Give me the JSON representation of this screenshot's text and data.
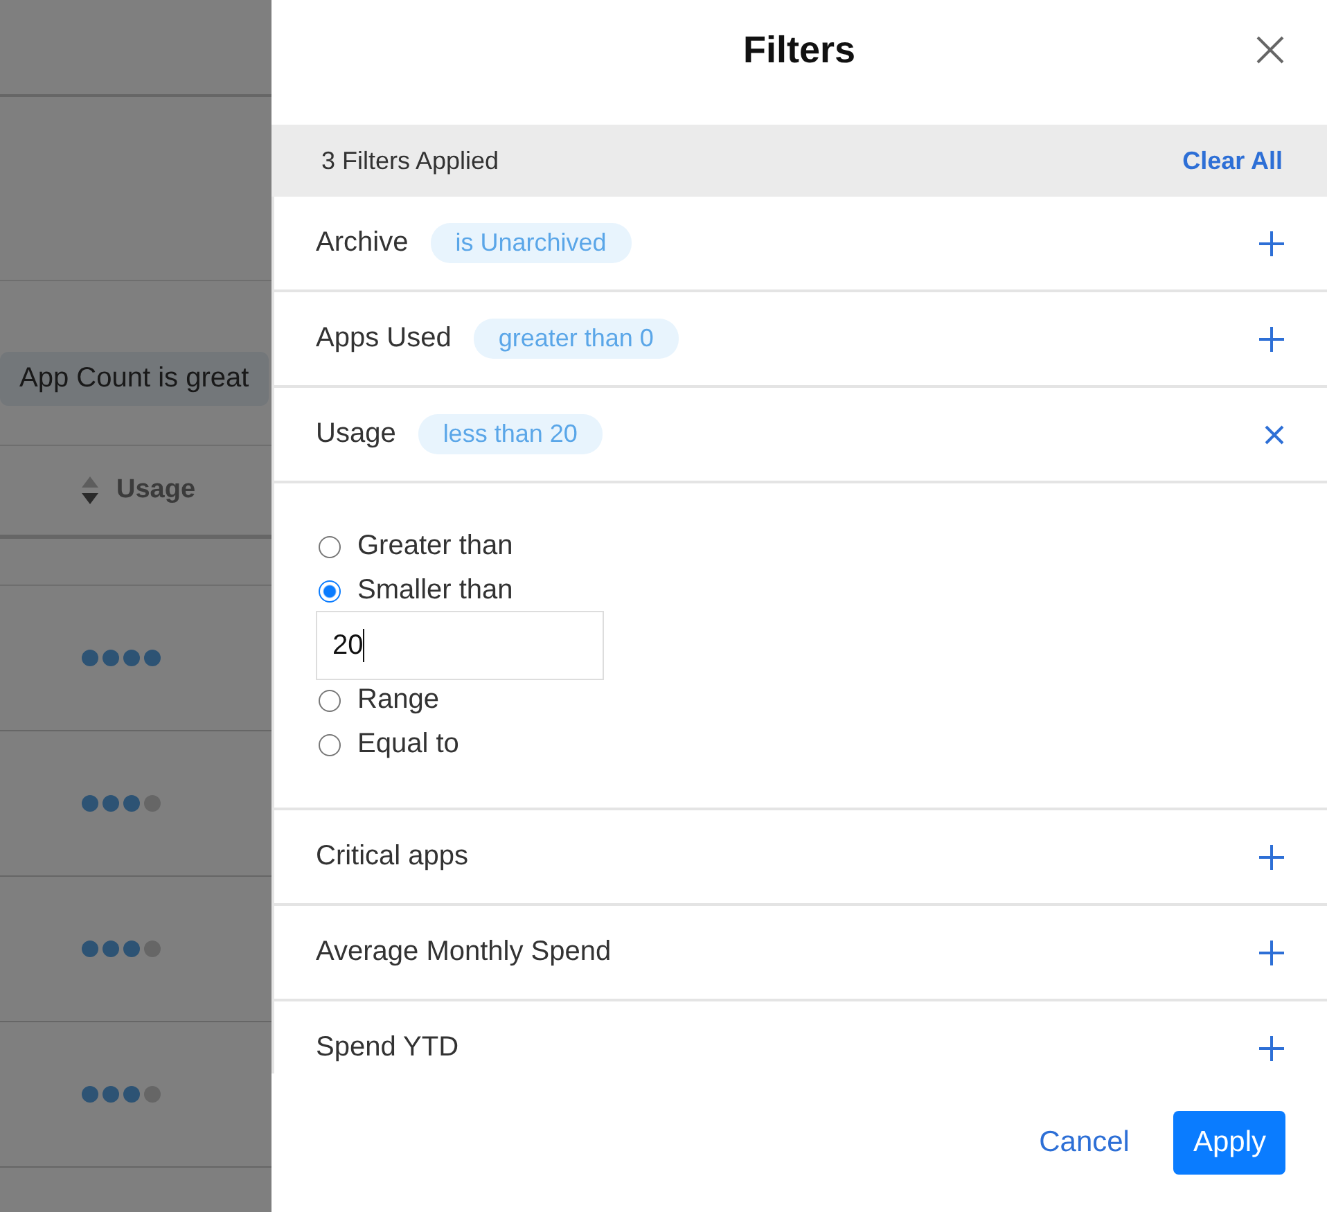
{
  "background": {
    "filter_chip": "App Count is great",
    "columns": [
      {
        "label": "Usage"
      }
    ],
    "rows": [
      {
        "stars": 4
      },
      {
        "stars": 3
      },
      {
        "stars": 3
      },
      {
        "stars": 3
      }
    ]
  },
  "drawer": {
    "title": "Filters",
    "applied_count": "3 Filters Applied",
    "clear_all": "Clear All",
    "filters": [
      {
        "label": "Archive",
        "value": "is Unarchived",
        "expanded": false
      },
      {
        "label": "Apps Used",
        "value": "greater than 0",
        "expanded": false
      },
      {
        "label": "Usage",
        "value": "less than 20",
        "expanded": true,
        "options": [
          {
            "label": "Greater than",
            "selected": false
          },
          {
            "label": "Smaller than",
            "selected": true
          },
          {
            "label": "Range",
            "selected": false
          },
          {
            "label": "Equal to",
            "selected": false
          }
        ],
        "input_value": "20"
      },
      {
        "label": "Critical apps",
        "expanded": false
      },
      {
        "label": "Average Monthly Spend",
        "expanded": false
      },
      {
        "label": "Spend YTD",
        "expanded": false
      }
    ],
    "cancel": "Cancel",
    "apply": "Apply"
  }
}
